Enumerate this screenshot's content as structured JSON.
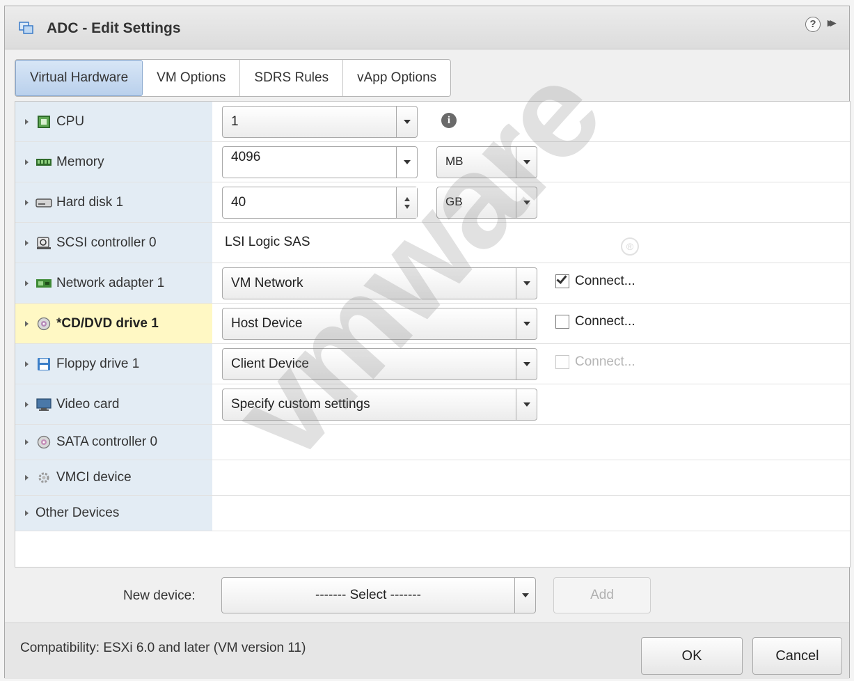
{
  "dialog": {
    "title": "ADC - Edit Settings",
    "help_icon": "question-circle-icon",
    "help_glyph": "?",
    "expand_icon": "double-chevron-right-icon",
    "expand_glyph": "▸▸"
  },
  "tabs": [
    {
      "label": "Virtual Hardware",
      "active": true
    },
    {
      "label": "VM Options",
      "active": false
    },
    {
      "label": "SDRS Rules",
      "active": false
    },
    {
      "label": "vApp Options",
      "active": false
    }
  ],
  "hardware": {
    "cpu": {
      "label": "CPU",
      "value": "1",
      "icon": "cpu-icon",
      "info_glyph": "i"
    },
    "memory": {
      "label": "Memory",
      "value": "4096",
      "unit": "MB",
      "icon": "memory-icon"
    },
    "hard_disk": {
      "label": "Hard disk 1",
      "value": "40",
      "unit": "GB",
      "icon": "hard-disk-icon"
    },
    "scsi": {
      "label": "SCSI controller 0",
      "value": "LSI Logic SAS",
      "icon": "scsi-controller-icon"
    },
    "network": {
      "label": "Network adapter 1",
      "value": "VM Network",
      "connect_label": "Connect...",
      "connected": true,
      "icon": "network-adapter-icon"
    },
    "cddvd": {
      "label": "*CD/DVD drive 1",
      "value": "Host Device",
      "connect_label": "Connect...",
      "connected": false,
      "icon": "cd-dvd-icon"
    },
    "floppy": {
      "label": "Floppy drive 1",
      "value": "Client Device",
      "connect_label": "Connect...",
      "connected": false,
      "disabled": true,
      "icon": "floppy-icon"
    },
    "video": {
      "label": "Video card",
      "value": "Specify custom settings",
      "icon": "video-card-icon"
    },
    "sata": {
      "label": "SATA controller 0",
      "icon": "sata-controller-icon"
    },
    "vmci": {
      "label": "VMCI device",
      "icon": "vmci-device-icon"
    },
    "other": {
      "label": "Other Devices"
    }
  },
  "new_device": {
    "label": "New device:",
    "select_value": "------- Select -------",
    "add_label": "Add"
  },
  "footer": {
    "compatibility": "Compatibility: ESXi 6.0 and later (VM version 11)",
    "ok_label": "OK",
    "cancel_label": "Cancel"
  },
  "watermark": {
    "text": "vmware",
    "reg": "®"
  },
  "colors": {
    "active_tab": "#c6d9f0",
    "label_column": "#e3ecf4",
    "highlight_row": "#fff8c4"
  }
}
